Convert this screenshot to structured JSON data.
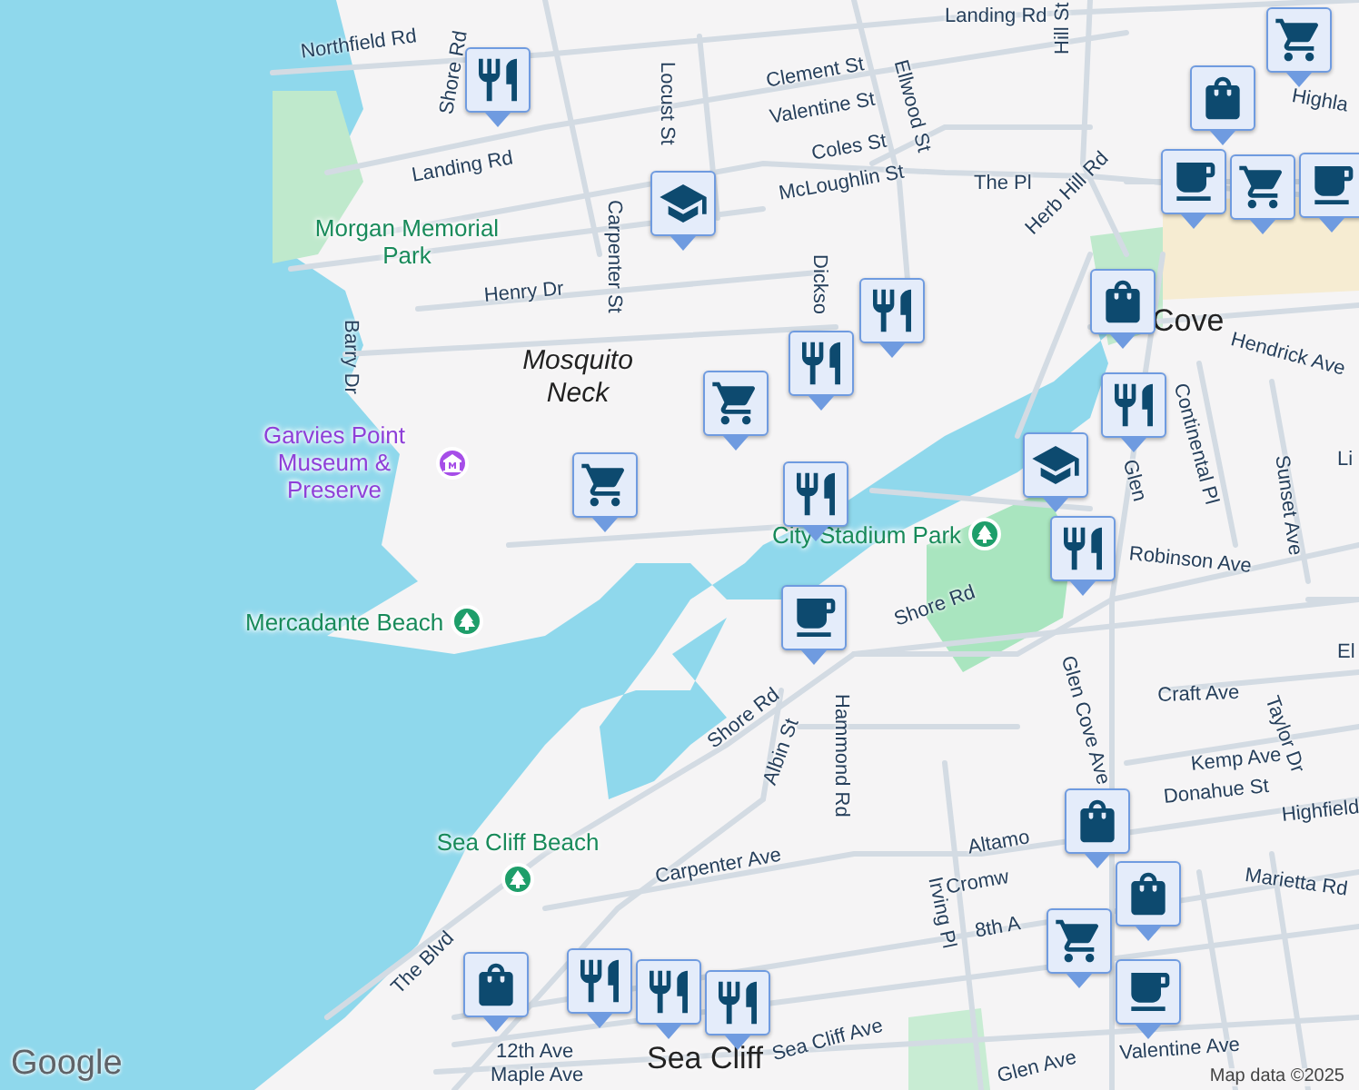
{
  "map": {
    "street_labels": [
      {
        "text": "Landing Rd"
      },
      {
        "text": "Northfield Rd"
      },
      {
        "text": "Shore Rd"
      },
      {
        "text": "Landing Rd"
      },
      {
        "text": "Clement St"
      },
      {
        "text": "Valentine St"
      },
      {
        "text": "Coles St"
      },
      {
        "text": "McLoughlin St"
      },
      {
        "text": "Locust St"
      },
      {
        "text": "Carpenter St"
      },
      {
        "text": "Ellwood St"
      },
      {
        "text": "Dickso"
      },
      {
        "text": "The Pl"
      },
      {
        "text": "Hill St"
      },
      {
        "text": "Herb Hill Rd"
      },
      {
        "text": "Henry Dr"
      },
      {
        "text": "Barry Dr"
      },
      {
        "text": "Hendrick Ave"
      },
      {
        "text": "Continental Pl"
      },
      {
        "text": "Sunset Ave"
      },
      {
        "text": "Highla"
      },
      {
        "text": "Li"
      },
      {
        "text": "Robinson Ave"
      },
      {
        "text": "Glen Cove Ave"
      },
      {
        "text": "Shore Rd"
      },
      {
        "text": "Shore Rd"
      },
      {
        "text": "Hammond Rd"
      },
      {
        "text": "Albin St"
      },
      {
        "text": "Craft Ave"
      },
      {
        "text": "Taylor Dr"
      },
      {
        "text": "Kemp Ave"
      },
      {
        "text": "Donahue St"
      },
      {
        "text": "Highfield"
      },
      {
        "text": "Marietta Rd"
      },
      {
        "text": "El"
      },
      {
        "text": "Carpenter Ave"
      },
      {
        "text": "Altamo"
      },
      {
        "text": "Cromw"
      },
      {
        "text": "8th A"
      },
      {
        "text": "Irving Pl"
      },
      {
        "text": "The Blvd"
      },
      {
        "text": "12th Ave"
      },
      {
        "text": "Maple Ave"
      },
      {
        "text": "Sea Cliff Ave"
      },
      {
        "text": "Glen Ave"
      },
      {
        "text": "Valentine Ave"
      },
      {
        "text": "Glen"
      }
    ],
    "place_labels": [
      {
        "text": "Mosquito Neck",
        "kind": "neighborhood"
      },
      {
        "text": "Cove",
        "kind": "town"
      },
      {
        "text": "Sea Cliff",
        "kind": "town"
      }
    ],
    "poi_labels": [
      {
        "text": "Morgan Memorial Park",
        "kind": "park-text"
      },
      {
        "text": "Garvies Point Museum & Preserve",
        "kind": "museum"
      },
      {
        "text": "City Stadium Park",
        "kind": "park"
      },
      {
        "text": "Mercadante Beach",
        "kind": "park"
      },
      {
        "text": "Sea Cliff Beach",
        "kind": "park"
      }
    ],
    "markers": [
      {
        "kind": "grocery"
      },
      {
        "kind": "shopping"
      },
      {
        "kind": "cafe"
      },
      {
        "kind": "grocery"
      },
      {
        "kind": "cafe"
      },
      {
        "kind": "dining"
      },
      {
        "kind": "school"
      },
      {
        "kind": "dining"
      },
      {
        "kind": "dining"
      },
      {
        "kind": "grocery"
      },
      {
        "kind": "grocery"
      },
      {
        "kind": "dining"
      },
      {
        "kind": "cafe"
      },
      {
        "kind": "shopping"
      },
      {
        "kind": "dining"
      },
      {
        "kind": "school"
      },
      {
        "kind": "dining"
      },
      {
        "kind": "shopping"
      },
      {
        "kind": "shopping"
      },
      {
        "kind": "grocery"
      },
      {
        "kind": "cafe"
      },
      {
        "kind": "shopping"
      },
      {
        "kind": "dining"
      },
      {
        "kind": "dining"
      },
      {
        "kind": "dining"
      }
    ],
    "logo": "Google",
    "attribution": "Map data ©2025"
  }
}
